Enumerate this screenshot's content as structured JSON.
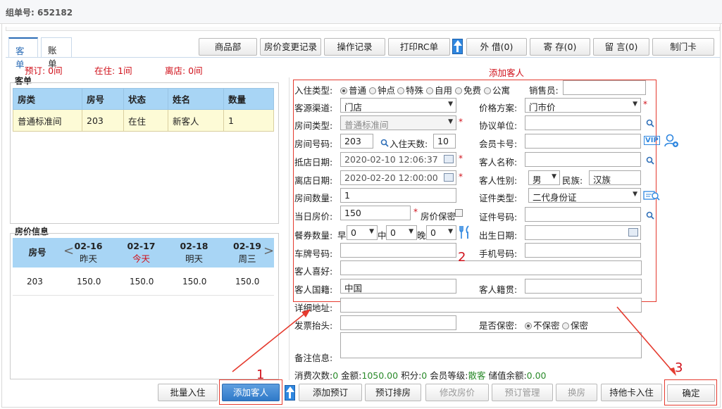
{
  "header": {
    "group_no": "组单号: 652182"
  },
  "tabs": [
    "客单",
    "账单"
  ],
  "top_buttons": [
    "商品部",
    "房价变更记录",
    "操作记录",
    "打印RC单",
    "外 借(0)",
    "寄 存(0)",
    "留 言(0)",
    "制门卡"
  ],
  "status": {
    "booked": "预订: 0间",
    "staying": "在住: 1间",
    "departed": "离店: 0间"
  },
  "order_section": {
    "title": "客单",
    "columns": [
      "房类",
      "房号",
      "状态",
      "姓名",
      "数量"
    ],
    "rows": [
      [
        "普通标准间",
        "203",
        "在住",
        "新客人",
        "1"
      ]
    ]
  },
  "rate_section": {
    "title": "房价信息",
    "room_col": "房号",
    "days": [
      {
        "date": "02-16",
        "label": "昨天"
      },
      {
        "date": "02-17",
        "label": "今天"
      },
      {
        "date": "02-18",
        "label": "明天"
      },
      {
        "date": "02-19",
        "label": "周三"
      }
    ],
    "rows": [
      {
        "room": "203",
        "prices": [
          "150.0",
          "150.0",
          "150.0",
          "150.0"
        ]
      }
    ]
  },
  "form": {
    "title": "添加客人",
    "checkin_type_label": "入住类型:",
    "checkin_types": [
      "普通",
      "钟点",
      "特殊",
      "自用",
      "免费",
      "公寓"
    ],
    "salesperson_label": "销售员:",
    "source_label": "客源渠道:",
    "source_value": "门店",
    "price_plan_label": "价格方案:",
    "price_plan_value": "门市价",
    "room_type_label": "房间类型:",
    "room_type_value": "普通标准间",
    "agreement_label": "协议单位:",
    "room_no_label": "房间号码:",
    "room_no_value": "203",
    "stay_days_label": "入住天数:",
    "stay_days_value": "10",
    "member_card_label": "会员卡号:",
    "vip_label": "VIP",
    "arrive_label": "抵店日期:",
    "arrive_value": "2020-02-10 12:06:37",
    "guest_name_label": "客人名称:",
    "depart_label": "离店日期:",
    "depart_value": "2020-02-20 12:00:00",
    "gender_label": "客人性别:",
    "gender_value": "男",
    "ethnic_label": "民族:",
    "ethnic_value": "汉族",
    "room_count_label": "房间数量:",
    "room_count_value": "1",
    "id_type_label": "证件类型:",
    "id_type_value": "二代身份证",
    "day_price_label": "当日房价:",
    "day_price_value": "150",
    "price_secret_label": "房价保密",
    "id_no_label": "证件号码:",
    "meal_label": "餐券数量:",
    "meal_b": "早",
    "meal_l": "中",
    "meal_d": "晚",
    "meal_val": "0",
    "birth_label": "出生日期:",
    "plate_label": "车牌号码:",
    "phone_label": "手机号码:",
    "hobby_label": "客人喜好:",
    "nation_label": "客人国籍:",
    "nation_value": "中国",
    "origin_label": "客人籍贯:",
    "address_label": "详细地址:",
    "invoice_label": "发票抬头:",
    "secret_label": "是否保密:",
    "secret_opts": [
      "不保密",
      "保密"
    ],
    "remark_label": "备注信息:",
    "footer": {
      "consume": "消费次数:",
      "consume_v": "0",
      "amount": "金额:",
      "amount_v": "1050.00",
      "points": "积分:",
      "points_v": "0",
      "level": "会员等级:",
      "level_v": "散客",
      "balance": "储值余额:",
      "balance_v": "0.00"
    }
  },
  "bottom_buttons": [
    "批量入住",
    "添加客人",
    "添加预订",
    "预订排房",
    "修改房价",
    "预订管理",
    "换房",
    "持他卡入住",
    "确定"
  ],
  "annotations": [
    "1",
    "2",
    "3"
  ]
}
